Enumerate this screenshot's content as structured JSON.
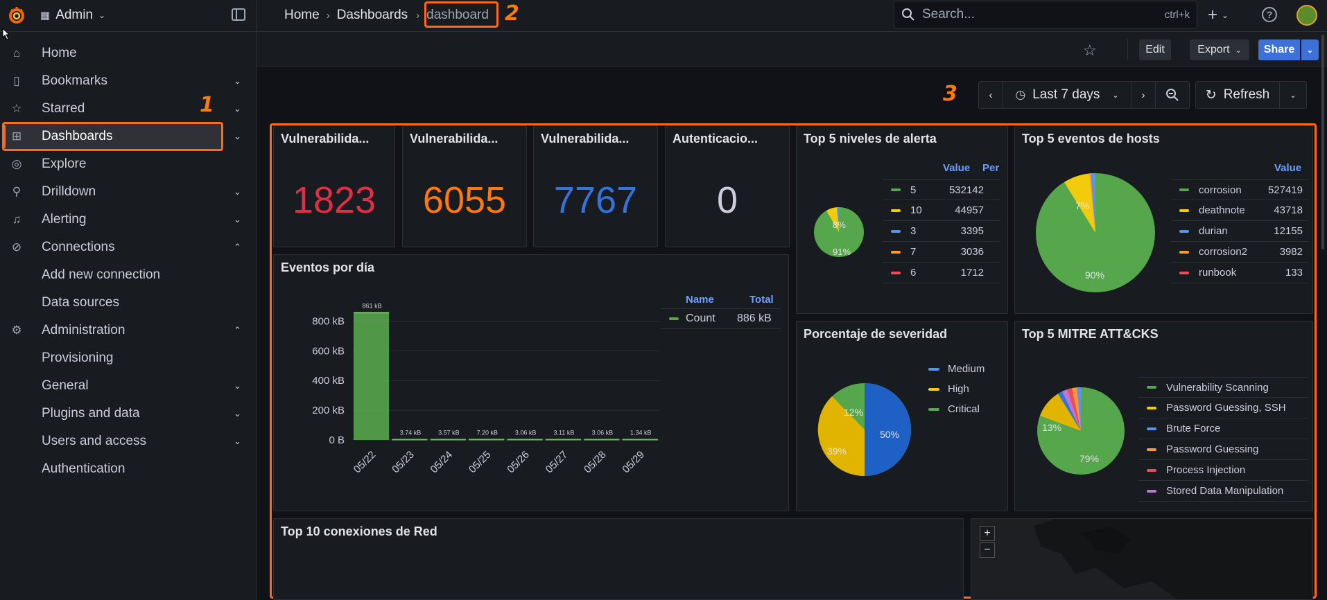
{
  "org": {
    "name": "Admin"
  },
  "breadcrumb": [
    "Home",
    "Dashboards",
    "dashboard"
  ],
  "search": {
    "placeholder": "Search...",
    "shortcut": "ctrl+k"
  },
  "sidebar": {
    "items": [
      {
        "label": "Home",
        "icon": "home-icon"
      },
      {
        "label": "Bookmarks",
        "icon": "bookmark-icon"
      },
      {
        "label": "Starred",
        "icon": "star-icon"
      },
      {
        "label": "Dashboards",
        "icon": "dashboards-icon"
      },
      {
        "label": "Explore",
        "icon": "compass-icon"
      },
      {
        "label": "Drilldown",
        "icon": "drilldown-icon"
      },
      {
        "label": "Alerting",
        "icon": "bell-icon"
      },
      {
        "label": "Connections",
        "icon": "connections-icon"
      },
      {
        "label": "Add new connection"
      },
      {
        "label": "Data sources"
      },
      {
        "label": "Administration",
        "icon": "gear-icon"
      },
      {
        "label": "Provisioning"
      },
      {
        "label": "General"
      },
      {
        "label": "Plugins and data"
      },
      {
        "label": "Users and access"
      },
      {
        "label": "Authentication"
      }
    ]
  },
  "annotations": {
    "one": "1",
    "two": "2",
    "three": "3"
  },
  "toolbar": {
    "edit": "Edit",
    "export": "Export",
    "share": "Share"
  },
  "timepicker": {
    "range": "Last 7 days",
    "refresh": "Refresh"
  },
  "stats": [
    {
      "title": "Vulnerabilida...",
      "value": "1823",
      "color": "#e02f44"
    },
    {
      "title": "Vulnerabilida...",
      "value": "6055",
      "color": "#ff780a"
    },
    {
      "title": "Vulnerabilida...",
      "value": "7767",
      "color": "#3274d9"
    },
    {
      "title": "Autenticacio...",
      "value": "0",
      "color": "#ccccdc"
    }
  ],
  "panels": {
    "alert_levels": {
      "title": "Top 5 niveles de alerta",
      "col_value": "Value",
      "col_pct": "Per",
      "pie_labels": [
        "8%",
        "91%"
      ],
      "rows": [
        {
          "name": "5",
          "value": "532142",
          "color": "#56a64b"
        },
        {
          "name": "10",
          "value": "44957",
          "color": "#f2cc0c"
        },
        {
          "name": "3",
          "value": "3395",
          "color": "#5794f2"
        },
        {
          "name": "7",
          "value": "3036",
          "color": "#ff9830"
        },
        {
          "name": "6",
          "value": "1712",
          "color": "#f2495c"
        }
      ]
    },
    "host_events": {
      "title": "Top 5 eventos de hosts",
      "col_value": "Value",
      "pie_labels": [
        "7%",
        "90%"
      ],
      "rows": [
        {
          "name": "corrosion",
          "value": "527419",
          "color": "#56a64b"
        },
        {
          "name": "deathnote",
          "value": "43718",
          "color": "#f2cc0c"
        },
        {
          "name": "durian",
          "value": "12155",
          "color": "#5794f2"
        },
        {
          "name": "corrosion2",
          "value": "3982",
          "color": "#ff9830"
        },
        {
          "name": "runbook",
          "value": "133",
          "color": "#f2495c"
        }
      ]
    },
    "events_day": {
      "title": "Eventos por día",
      "col_name": "Name",
      "col_total": "Total",
      "legend_name": "Count",
      "legend_total": "886 kB"
    },
    "severity": {
      "title": "Porcentaje de severidad",
      "legend": [
        {
          "name": "Medium",
          "color": "#5794f2"
        },
        {
          "name": "High",
          "color": "#f2cc0c"
        },
        {
          "name": "Critical",
          "color": "#56a64b"
        }
      ],
      "pie_labels": [
        "12%",
        "39%",
        "50%"
      ]
    },
    "mitre": {
      "title": "Top 5 MITRE ATT&CKS",
      "pie_labels": [
        "13%",
        "79%"
      ],
      "rows": [
        {
          "name": "Vulnerability Scanning",
          "color": "#56a64b"
        },
        {
          "name": "Password Guessing, SSH",
          "color": "#f2cc0c"
        },
        {
          "name": "Brute Force",
          "color": "#5794f2"
        },
        {
          "name": "Password Guessing",
          "color": "#ff9830"
        },
        {
          "name": "Process Injection",
          "color": "#f2495c"
        },
        {
          "name": "Stored Data Manipulation",
          "color": "#b877d9"
        }
      ]
    },
    "network": {
      "title": "Top 10 conexiones de Red"
    },
    "map": {
      "zoom_in": "+",
      "zoom_out": "−"
    }
  },
  "chart_data": [
    {
      "type": "bar",
      "title": "Eventos por día",
      "categories": [
        "05/22",
        "05/23",
        "05/24",
        "05/25",
        "05/26",
        "05/27",
        "05/28",
        "05/29"
      ],
      "series": [
        {
          "name": "Count",
          "values": [
            861,
            3.74,
            3.57,
            7.2,
            3.06,
            3.11,
            3.06,
            1.34
          ]
        }
      ],
      "value_labels": [
        "861 kB",
        "3.74 kB",
        "3.57 kB",
        "7.20 kB",
        "3.06 kB",
        "3.11 kB",
        "3.06 kB",
        "1.34 kB"
      ],
      "yticks": [
        "0 B",
        "200 kB",
        "400 kB",
        "600 kB",
        "800 kB"
      ],
      "ylim": [
        0,
        900
      ],
      "color": "#56a64b"
    },
    {
      "type": "pie",
      "title": "Top 5 niveles de alerta",
      "categories": [
        "5",
        "10",
        "3",
        "7",
        "6"
      ],
      "values": [
        532142,
        44957,
        3395,
        3036,
        1712
      ]
    },
    {
      "type": "pie",
      "title": "Top 5 eventos de hosts",
      "categories": [
        "corrosion",
        "deathnote",
        "durian",
        "corrosion2",
        "runbook"
      ],
      "values": [
        527419,
        43718,
        12155,
        3982,
        133
      ]
    },
    {
      "type": "pie",
      "title": "Porcentaje de severidad",
      "categories": [
        "Medium",
        "High",
        "Critical"
      ],
      "values": [
        50,
        39,
        12
      ]
    },
    {
      "type": "pie",
      "title": "Top 5 MITRE ATT&CKS",
      "categories": [
        "Vulnerability Scanning",
        "Password Guessing, SSH",
        "Brute Force",
        "Password Guessing",
        "Process Injection",
        "Stored Data Manipulation"
      ],
      "values": [
        79,
        13,
        2,
        2,
        2,
        2
      ]
    }
  ]
}
